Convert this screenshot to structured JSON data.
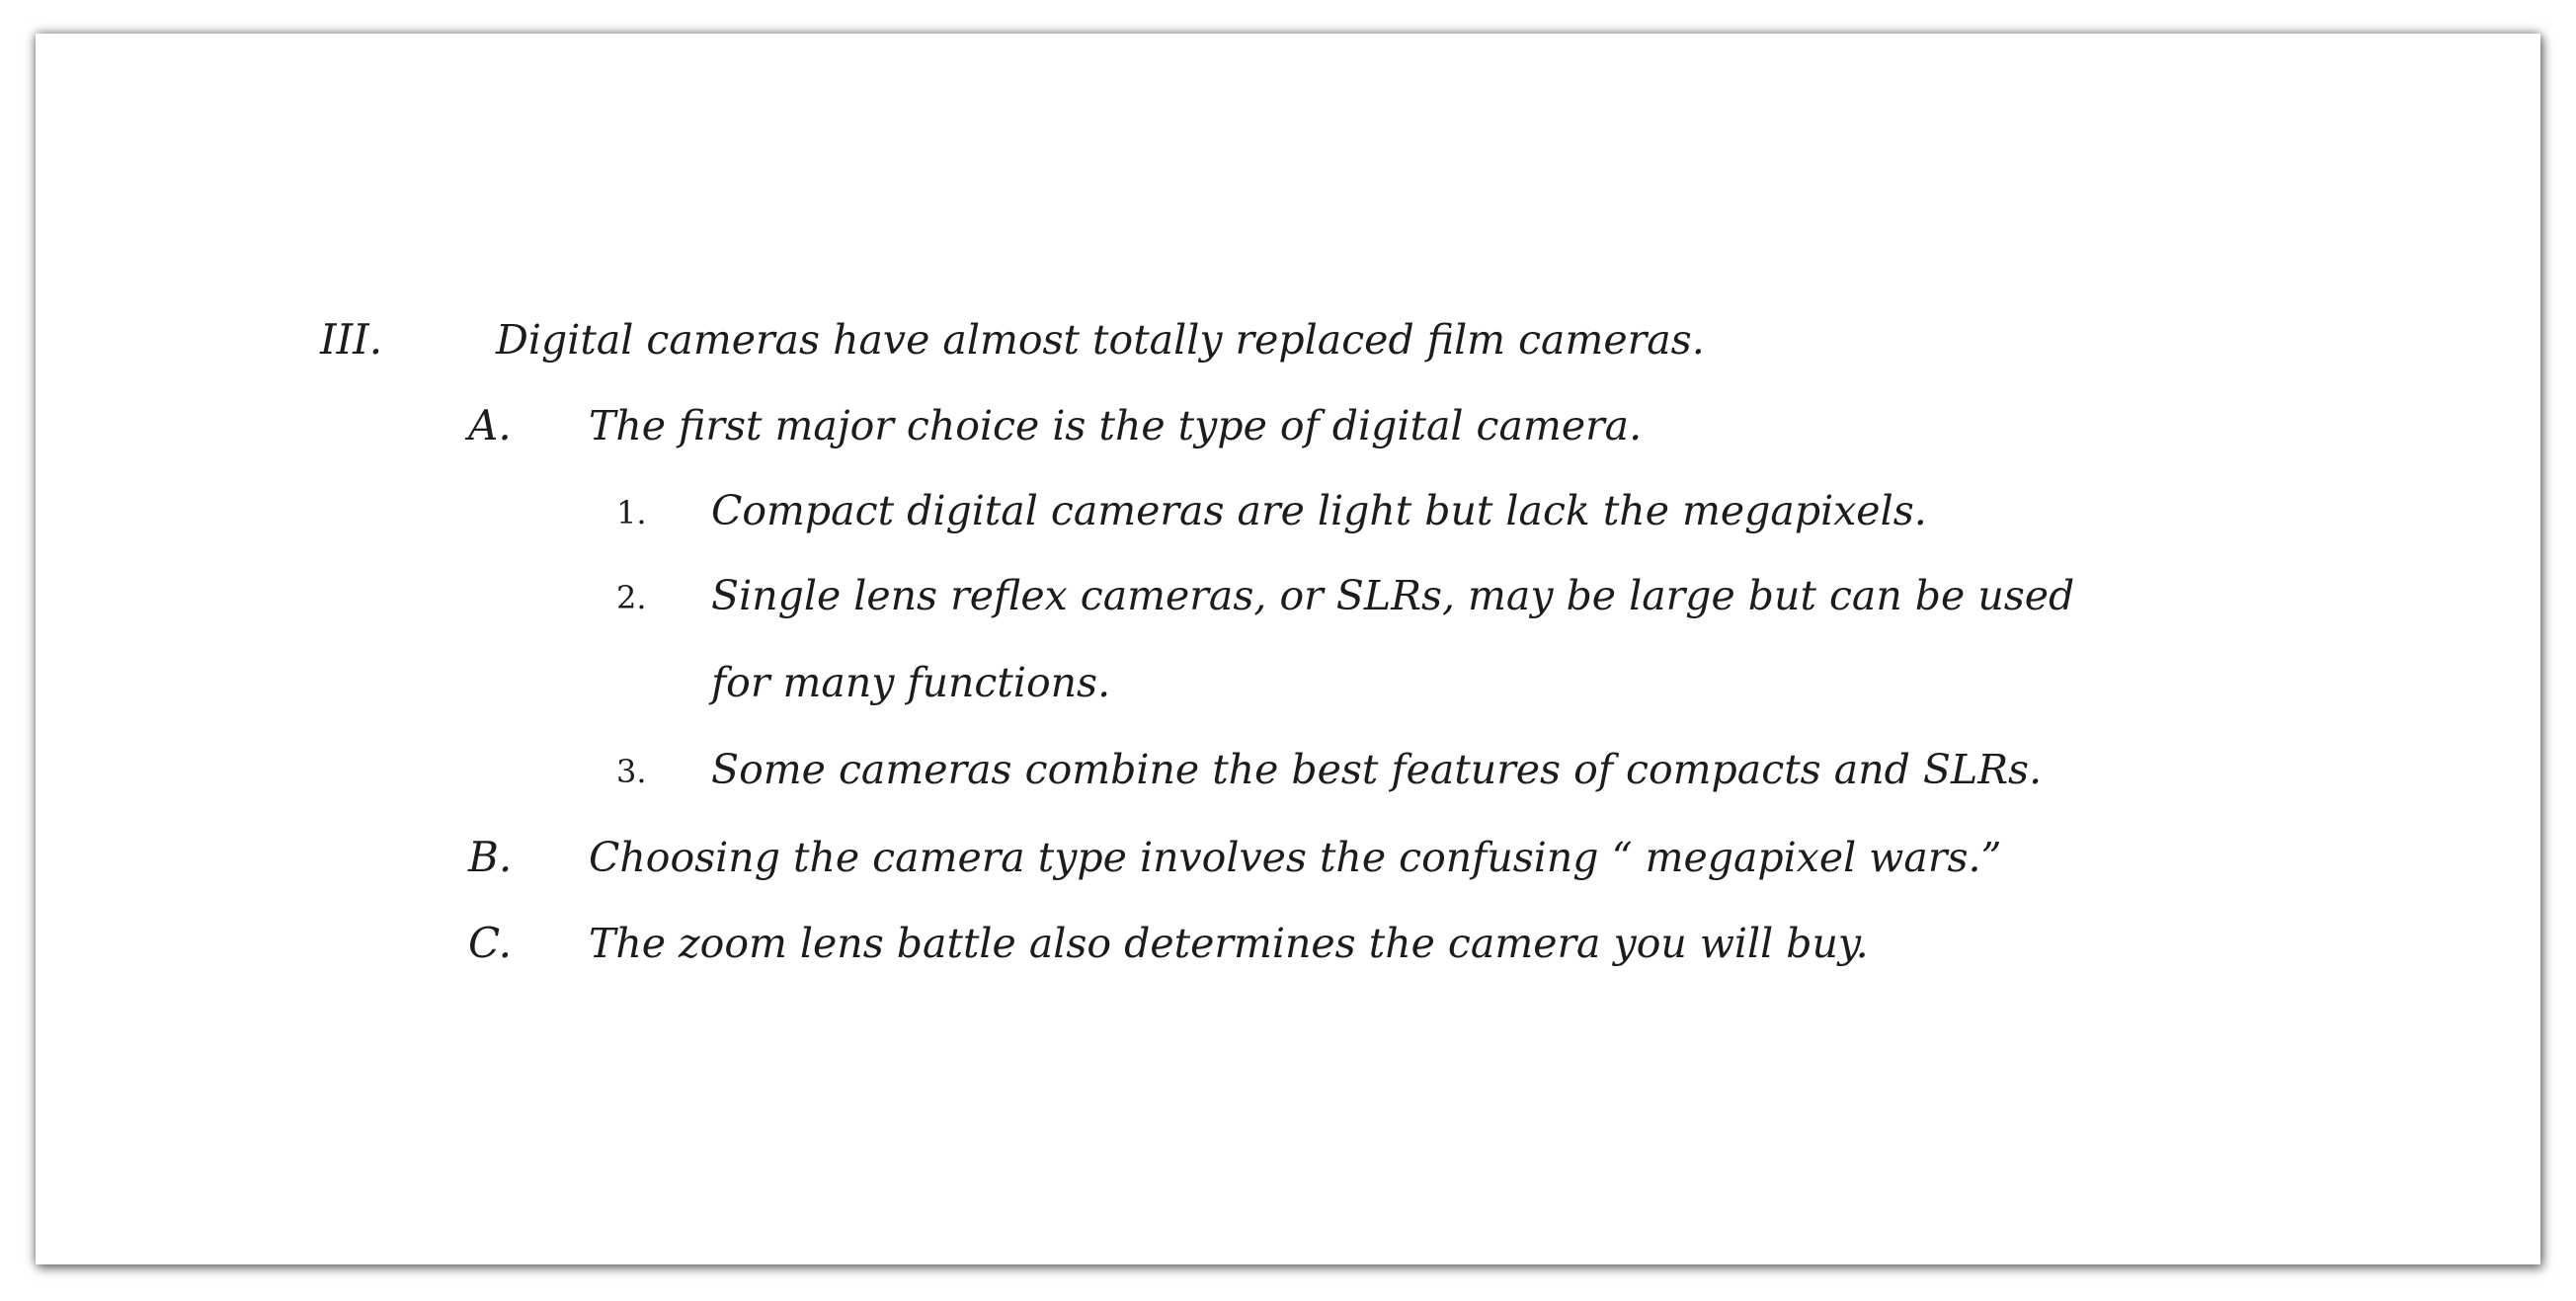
{
  "outline": {
    "main": {
      "marker": "III.",
      "text": "Digital cameras have almost totally replaced film cameras."
    },
    "sub_a": {
      "marker": "A.",
      "text": "The first major choice is the type of digital camera."
    },
    "items": [
      {
        "marker": "1.",
        "text": "Compact digital cameras are light but lack the megapixels."
      },
      {
        "marker": "2.",
        "text": "Single lens reflex cameras, or SLRs, may be large but can be used",
        "continuation": "for many functions."
      },
      {
        "marker": "3.",
        "text": "Some cameras combine the best features of compacts and SLRs."
      }
    ],
    "sub_b": {
      "marker": "B.",
      "text": "Choosing the camera type involves the confusing “ megapixel wars.”"
    },
    "sub_c": {
      "marker": "C.",
      "text": "The zoom lens battle also determines the camera you will buy."
    }
  }
}
